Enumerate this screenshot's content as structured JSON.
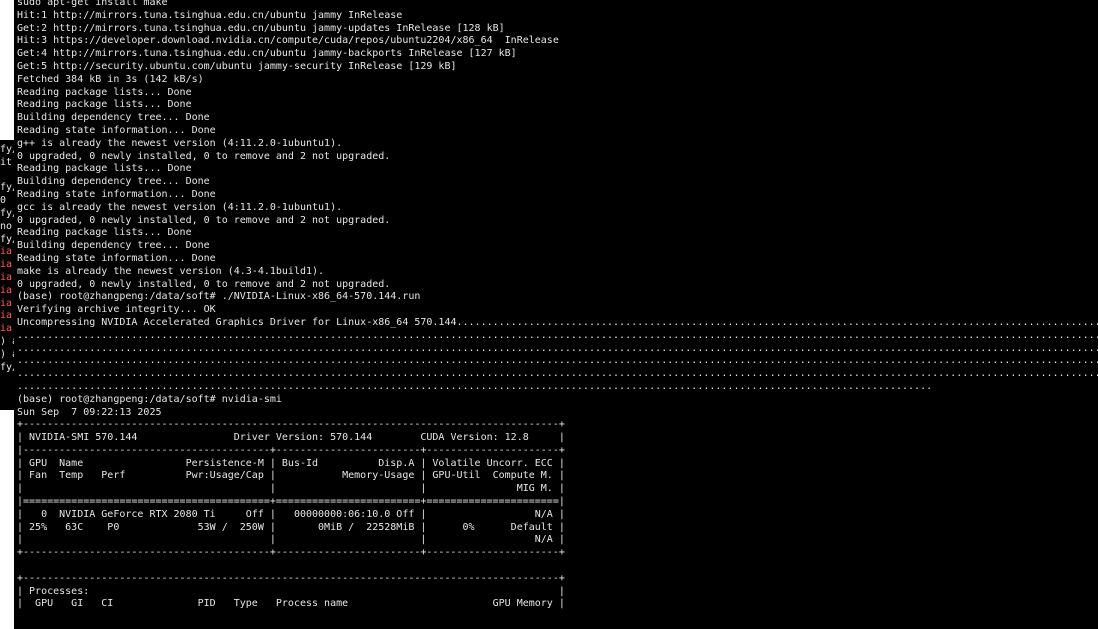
{
  "background_window": {
    "fragments": [
      {
        "text": "fy/",
        "color": "#e6e6e6"
      },
      {
        "text": "it",
        "color": "#e6e6e6"
      },
      {
        "text": "",
        "color": "#e6e6e6"
      },
      {
        "text": "fy/",
        "color": "#e6e6e6"
      },
      {
        "text": "0",
        "color": "#e6e6e6"
      },
      {
        "text": "fy/",
        "color": "#e6e6e6"
      },
      {
        "text": "no",
        "color": "#e6e6e6"
      },
      {
        "text": "fy/",
        "color": "#e6e6e6"
      },
      {
        "text": "ia",
        "color": "#ff5a5a"
      },
      {
        "text": "ia",
        "color": "#ff5a5a"
      },
      {
        "text": "ia",
        "color": "#ff5a5a"
      },
      {
        "text": "ia",
        "color": "#ff5a5a"
      },
      {
        "text": "ia",
        "color": "#ff5a5a"
      },
      {
        "text": "ia",
        "color": "#ff5a5a"
      },
      {
        "text": "ia",
        "color": "#ff5a5a"
      },
      {
        "text": ") a",
        "color": "#e6e6e6"
      },
      {
        "text": ") a",
        "color": "#e6e6e6"
      },
      {
        "text": "fy/",
        "color": "#e6e6e6"
      }
    ]
  },
  "terminal": {
    "theme": {
      "background": "#000000",
      "foreground": "#e6e6e6"
    },
    "lines": [
      "sudo apt-get install make",
      "Hit:1 http://mirrors.tuna.tsinghua.edu.cn/ubuntu jammy InRelease",
      "Get:2 http://mirrors.tuna.tsinghua.edu.cn/ubuntu jammy-updates InRelease [128 kB]",
      "Hit:3 https://developer.download.nvidia.cn/compute/cuda/repos/ubuntu2204/x86_64  InRelease",
      "Get:4 http://mirrors.tuna.tsinghua.edu.cn/ubuntu jammy-backports InRelease [127 kB]",
      "Get:5 http://security.ubuntu.com/ubuntu jammy-security InRelease [129 kB]",
      "Fetched 384 kB in 3s (142 kB/s)",
      "Reading package lists... Done",
      "Reading package lists... Done",
      "Building dependency tree... Done",
      "Reading state information... Done",
      "g++ is already the newest version (4:11.2.0-1ubuntu1).",
      "0 upgraded, 0 newly installed, 0 to remove and 2 not upgraded.",
      "Reading package lists... Done",
      "Building dependency tree... Done",
      "Reading state information... Done",
      "gcc is already the newest version (4:11.2.0-1ubuntu1).",
      "0 upgraded, 0 newly installed, 0 to remove and 2 not upgraded.",
      "Reading package lists... Done",
      "Building dependency tree... Done",
      "Reading state information... Done",
      "make is already the newest version (4.3-4.1build1).",
      "0 upgraded, 0 newly installed, 0 to remove and 2 not upgraded.",
      "(base) root@zhangpeng:/data/soft# ./NVIDIA-Linux-x86_64-570.144.run",
      "Verifying archive integrity... OK",
      "Uncompressing NVIDIA Accelerated Graphics Driver for Linux-x86_64 570.144.......................................................................................................................................",
      "........................................................................................................................................................................................................",
      "........................................................................................................................................................................................................",
      "........................................................................................................................................................................................................",
      "........................................................................................................................................................................................................",
      "........................................................................................................................................................",
      "(base) root@zhangpeng:/data/soft# nvidia-smi",
      "Sun Sep  7 09:22:13 2025",
      "+-----------------------------------------------------------------------------------------+",
      "| NVIDIA-SMI 570.144                Driver Version: 570.144        CUDA Version: 12.8     |",
      "|-----------------------------------------+------------------------+----------------------+",
      "| GPU  Name                 Persistence-M | Bus-Id          Disp.A | Volatile Uncorr. ECC |",
      "| Fan  Temp   Perf          Pwr:Usage/Cap |           Memory-Usage | GPU-Util  Compute M. |",
      "|                                         |                        |               MIG M. |",
      "|=========================================+========================+======================|",
      "|   0  NVIDIA GeForce RTX 2080 Ti     Off |   00000000:06:10.0 Off |                  N/A |",
      "| 25%   63C    P0             53W /  250W |       0MiB /  22528MiB |      0%      Default |",
      "|                                         |                        |                  N/A |",
      "+-----------------------------------------+------------------------+----------------------+",
      "",
      "+-----------------------------------------------------------------------------------------+",
      "| Processes:                                                                              |",
      "|  GPU   GI   CI              PID   Type   Process name                        GPU Memory |"
    ]
  }
}
